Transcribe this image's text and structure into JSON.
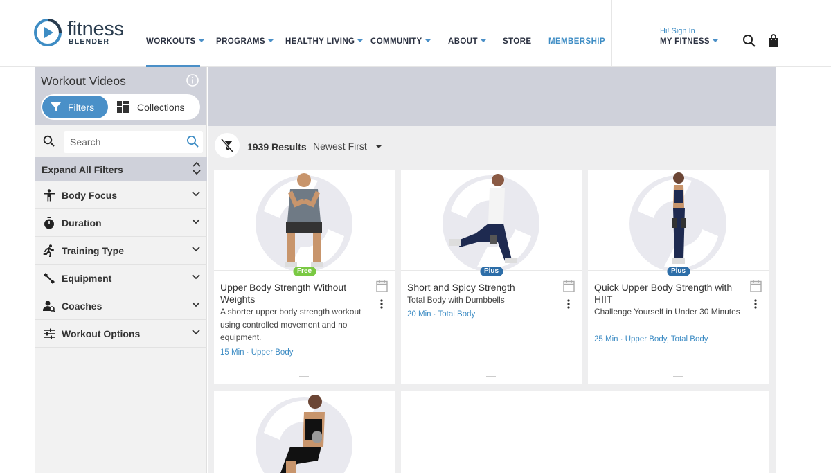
{
  "header": {
    "logo_word": "fitness",
    "logo_sub": "BLENDER",
    "nav": [
      {
        "label": "WORKOUTS",
        "caret": true
      },
      {
        "label": "PROGRAMS",
        "caret": true
      },
      {
        "label": "HEALTHY LIVING",
        "caret": true
      },
      {
        "label": "COMMUNITY",
        "caret": true
      },
      {
        "label": "ABOUT",
        "caret": true
      },
      {
        "label": "STORE",
        "caret": false
      },
      {
        "label": "MEMBERSHIP",
        "caret": false
      }
    ],
    "signin": "Hi! Sign In",
    "my_fitness": "MY FITNESS",
    "icons": [
      "search-icon",
      "shopping-bag-icon"
    ],
    "accent": "#4a8fc7"
  },
  "sidebar": {
    "title": "Workout Videos",
    "toggle_filters": "Filters",
    "toggle_collections": "Collections",
    "search_placeholder": "Search",
    "expand_all": "Expand All Filters",
    "filters": [
      {
        "label": "Body Focus",
        "icon": "body-icon"
      },
      {
        "label": "Duration",
        "icon": "stopwatch-icon"
      },
      {
        "label": "Training Type",
        "icon": "running-icon"
      },
      {
        "label": "Equipment",
        "icon": "dumbbell-icon"
      },
      {
        "label": "Coaches",
        "icon": "coach-icon"
      },
      {
        "label": "Workout Options",
        "icon": "sliders-icon"
      }
    ]
  },
  "results": {
    "count": "1939 Results",
    "sort": "Newest First"
  },
  "cards": [
    {
      "badge": "Free",
      "title": "Upper Body Strength Without Weights",
      "desc": "A shorter upper body strength workout using controlled movement and no equipment.",
      "meta": "15 Min · Upper Body"
    },
    {
      "badge": "Plus",
      "title": "Short and Spicy Strength",
      "desc": "Total Body with Dumbbells",
      "meta": "20 Min · Total Body"
    },
    {
      "badge": "Plus",
      "title": "Quick Upper Body Strength with HIIT",
      "desc": "Challenge Yourself in Under 30 Minutes",
      "meta": "25 Min · Upper Body, Total Body"
    }
  ]
}
